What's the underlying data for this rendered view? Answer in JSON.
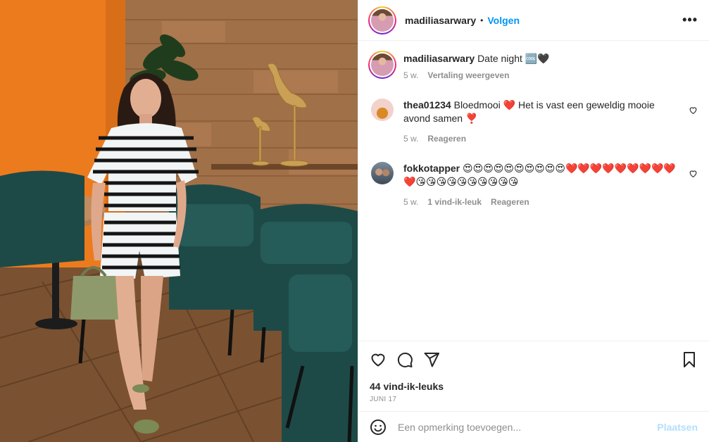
{
  "post": {
    "username": "madiliasarwary",
    "separator": "•",
    "follow_label": "Volgen",
    "more_label": "•••",
    "caption": {
      "username": "madiliasarwary",
      "text": "Date night 🆒🖤",
      "time": "5 w.",
      "translate_label": "Vertaling weergeven"
    }
  },
  "comments": [
    {
      "username": "thea01234",
      "text": "Bloedmooi ❤️ Het is vast een geweldig mooie avond samen ❣️",
      "time": "5 w.",
      "likes_label": "",
      "reply_label": "Reageren"
    },
    {
      "username": "fokkotapper",
      "text": "😍😍😍😍😍😍😍😍😍😍❤️❤️❤️❤️❤️❤️❤️❤️❤️❤️😘😘😘😘😘😘😘😘😘😘",
      "time": "5 w.",
      "likes_label": "1 vind-ik-leuk",
      "reply_label": "Reageren"
    }
  ],
  "footer": {
    "likes": "44 vind-ik-leuks",
    "date": "JUNI 17",
    "comment_placeholder": "Een opmerking toevoegen...",
    "post_label": "Plaatsen"
  },
  "colors": {
    "accent": "#0095f6",
    "post_disabled": "#b2dffc",
    "muted": "#8e8e8e"
  }
}
